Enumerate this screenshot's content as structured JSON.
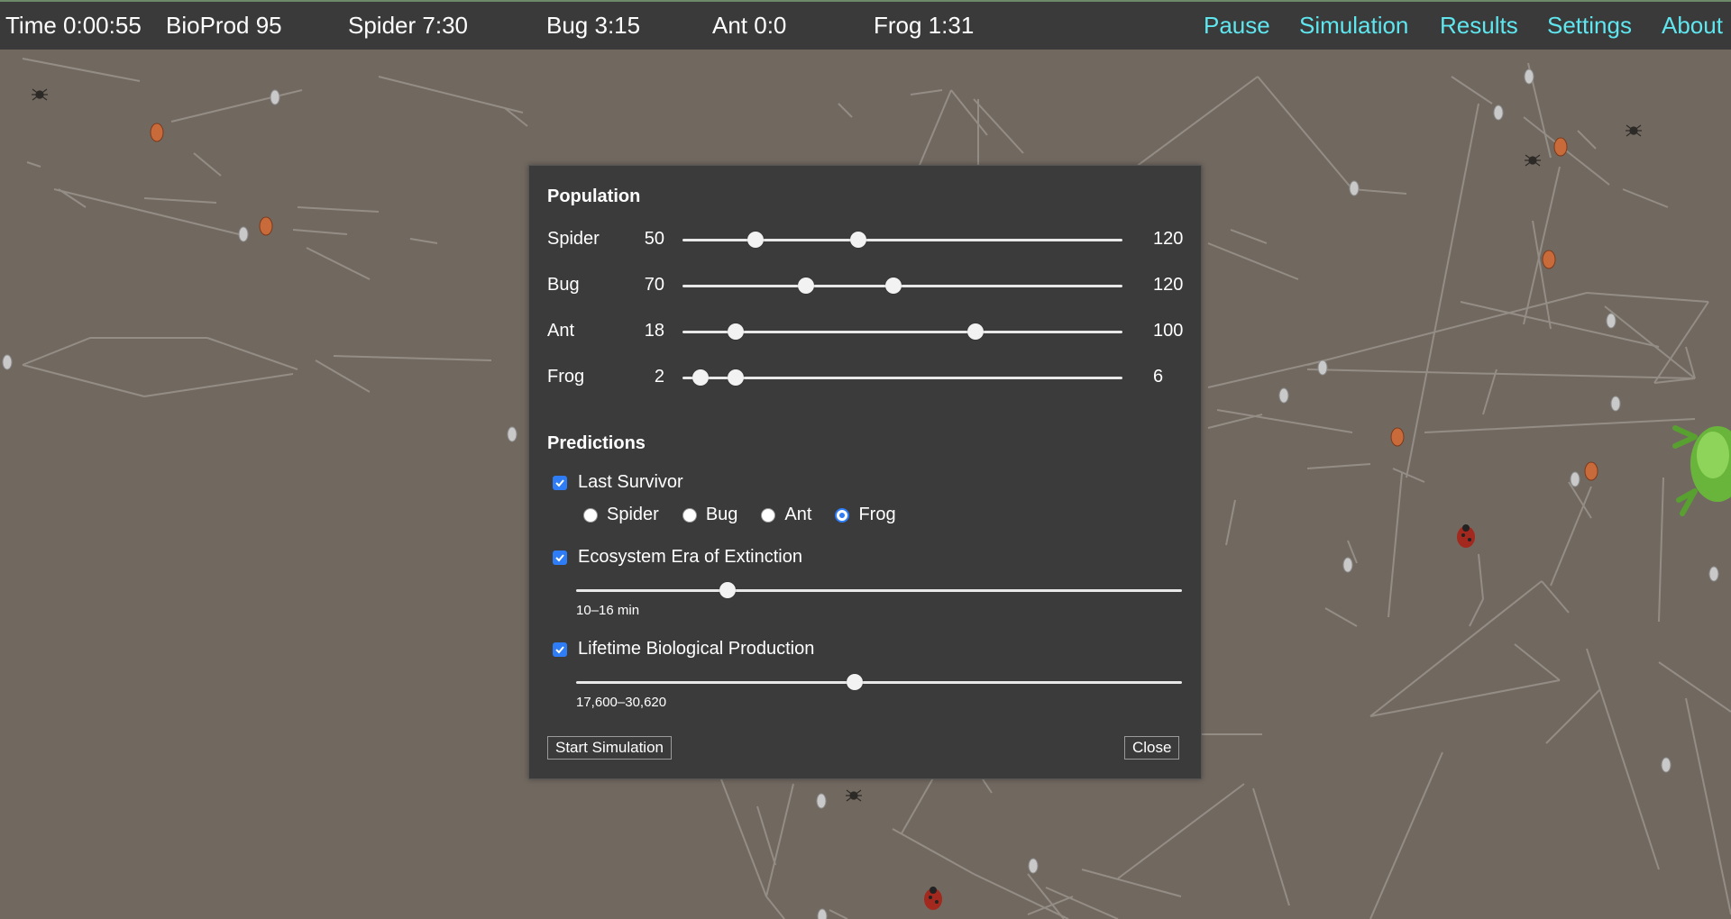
{
  "topbar": {
    "time": "Time 0:00:55",
    "bioprod": "BioProd 95",
    "spider": "Spider 7:30",
    "bug": "Bug 3:15",
    "ant": "Ant 0:0",
    "frog": "Frog 1:31",
    "nav": {
      "pause": "Pause",
      "simulation": "Simulation",
      "results": "Results",
      "settings": "Settings",
      "about": "About"
    },
    "nav_color": "#5fe6ef"
  },
  "dialog": {
    "population_title": "Population",
    "population": [
      {
        "name": "Spider",
        "min": "50",
        "max": "120",
        "low": 0.167,
        "high": 0.4
      },
      {
        "name": "Bug",
        "min": "70",
        "max": "120",
        "low": 0.28,
        "high": 0.48
      },
      {
        "name": "Ant",
        "min": "18",
        "max": "100",
        "low": 0.12,
        "high": 0.667
      },
      {
        "name": "Frog",
        "min": "2",
        "max": "6",
        "low": 0.04,
        "high": 0.12
      }
    ],
    "predictions_title": "Predictions",
    "last_survivor": {
      "label": "Last Survivor",
      "checked": true,
      "options": [
        "Spider",
        "Bug",
        "Ant",
        "Frog"
      ],
      "selected": "Frog"
    },
    "extinction": {
      "label": "Ecosystem Era of Extinction",
      "checked": true,
      "range_text": "10–16 min",
      "value": 0.25
    },
    "production": {
      "label": "Lifetime Biological Production",
      "checked": true,
      "range_text": "17,600–30,620",
      "value": 0.46
    },
    "start_button": "Start Simulation",
    "close_button": "Close"
  },
  "colors": {
    "background": "#716960",
    "topbar": "#3a3a3a",
    "dialog": "#3b3b3b",
    "accent": "#2e7cf6"
  }
}
